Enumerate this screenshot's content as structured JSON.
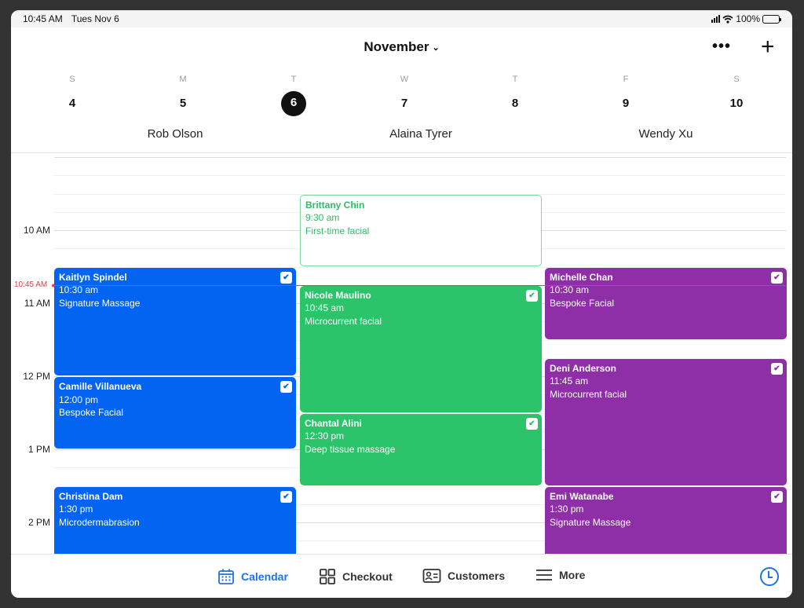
{
  "status_bar": {
    "time": "10:45 AM",
    "date": "Tues Nov 6",
    "battery": "100%"
  },
  "header": {
    "month": "November",
    "more_label": "•••",
    "add_label": "+",
    "days": [
      {
        "dow": "S",
        "num": "4"
      },
      {
        "dow": "M",
        "num": "5"
      },
      {
        "dow": "T",
        "num": "6",
        "selected": true
      },
      {
        "dow": "W",
        "num": "7"
      },
      {
        "dow": "T",
        "num": "8"
      },
      {
        "dow": "F",
        "num": "9"
      },
      {
        "dow": "S",
        "num": "10"
      }
    ],
    "staff": [
      "Rob Olson",
      "Alaina Tyrer",
      "Wendy Xu"
    ]
  },
  "timeline": {
    "hour_labels": [
      "10 AM",
      "11 AM",
      "12 PM",
      "1 PM",
      "2 PM"
    ],
    "current_time_label": "10:45 AM",
    "current_time_hours": 10.75
  },
  "colors": {
    "blue": "#0464f2",
    "green": "#2bc46b",
    "purple": "#8e2fa8",
    "now": "#d8424a",
    "accent": "#1a73e8"
  },
  "appointments": [
    {
      "staff": 0,
      "client": "Kaitlyn Spindel",
      "time": "10:30 am",
      "service": "Signature Massage",
      "start": 10.5,
      "end": 12.0,
      "color": "blue",
      "confirmed": true
    },
    {
      "staff": 0,
      "client": "Camille Villanueva",
      "time": "12:00 pm",
      "service": "Bespoke Facial",
      "start": 12.0,
      "end": 13.0,
      "color": "blue",
      "confirmed": true
    },
    {
      "staff": 0,
      "client": "Christina Dam",
      "time": "1:30 pm",
      "service": "Microdermabrasion",
      "start": 13.5,
      "end": 14.5,
      "color": "blue",
      "confirmed": true
    },
    {
      "staff": 1,
      "client": "Brittany Chin",
      "time": "9:30 am",
      "service": "First-time facial",
      "start": 9.5,
      "end": 10.5,
      "color": "green",
      "confirmed": false
    },
    {
      "staff": 1,
      "client": "Nicole Maulino",
      "time": "10:45 am",
      "service": "Microcurrent facial",
      "start": 10.75,
      "end": 12.5,
      "color": "green",
      "confirmed": true
    },
    {
      "staff": 1,
      "client": "Chantal Alini",
      "time": "12:30 pm",
      "service": "Deep tissue massage",
      "start": 12.5,
      "end": 13.5,
      "color": "green",
      "confirmed": true
    },
    {
      "staff": 2,
      "client": "Michelle Chan",
      "time": "10:30 am",
      "service": "Bespoke Facial",
      "start": 10.5,
      "end": 11.5,
      "color": "purple",
      "confirmed": true
    },
    {
      "staff": 2,
      "client": "Deni Anderson",
      "time": "11:45 am",
      "service": "Microcurrent facial",
      "start": 11.75,
      "end": 13.5,
      "color": "purple",
      "confirmed": true
    },
    {
      "staff": 2,
      "client": "Emi Watanabe",
      "time": "1:30 pm",
      "service": "Signature Massage",
      "start": 13.5,
      "end": 15.0,
      "color": "purple",
      "confirmed": true
    }
  ],
  "tabbar": {
    "tabs": [
      {
        "label": "Calendar",
        "icon": "calendar-icon",
        "active": true
      },
      {
        "label": "Checkout",
        "icon": "grid-icon"
      },
      {
        "label": "Customers",
        "icon": "contact-card-icon"
      },
      {
        "label": "More",
        "icon": "menu-icon"
      }
    ],
    "clock_icon": "clock-icon"
  }
}
